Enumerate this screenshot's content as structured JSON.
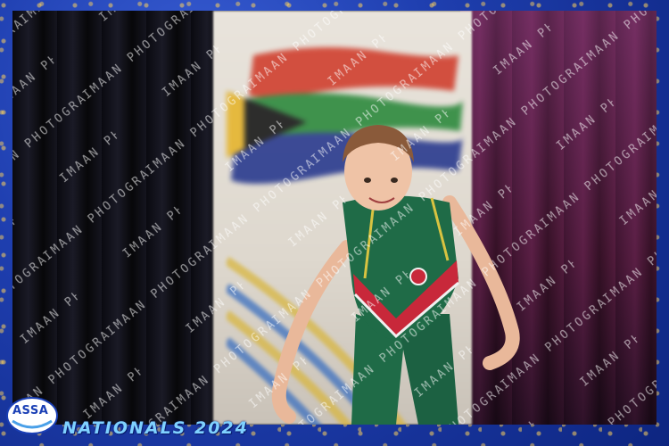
{
  "frame": {
    "border_color": "#1f3fb0",
    "accent_gold": "#ffd25a"
  },
  "watermark": {
    "text": "IMAAN PHOTOGRAPHY"
  },
  "logo": {
    "text": "ASSA"
  },
  "event": {
    "title": "NATIONALS 2024",
    "title_color": "#7fd1ff"
  },
  "subject": {
    "leotard_primary": "#1f6b47",
    "leotard_accent": "#c8283a",
    "trim": "#d8c341"
  }
}
